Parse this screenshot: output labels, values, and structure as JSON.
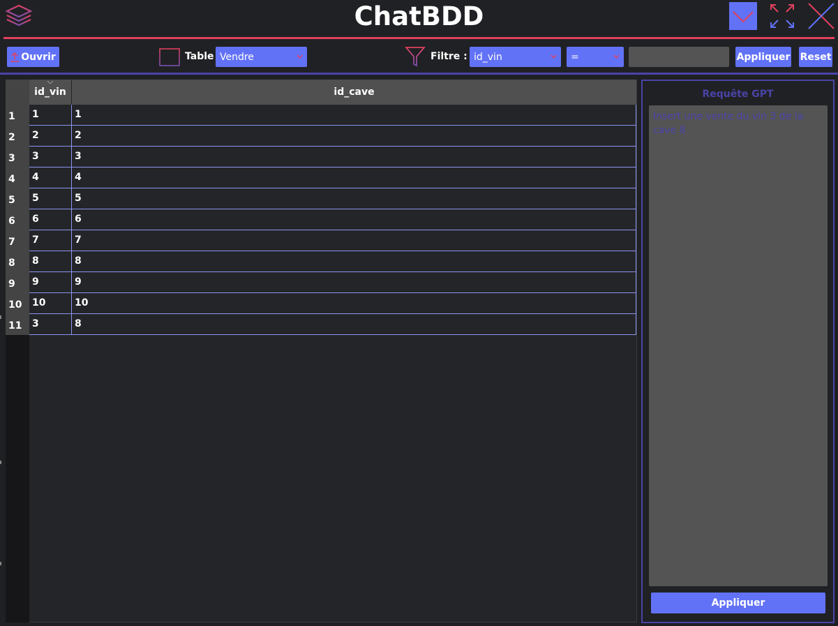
{
  "app": {
    "title": "ChatBDD"
  },
  "toolbar": {
    "open_label": "Ouvrir",
    "table_label": "Table",
    "table_selected": "Vendre",
    "filter_label": "Filtre :",
    "filter_column": "id_vin",
    "filter_operator": "=",
    "filter_value": "",
    "apply_label": "Appliquer",
    "reset_label": "Reset"
  },
  "table": {
    "columns": [
      "id_vin",
      "id_cave"
    ],
    "rows": [
      {
        "num": "1",
        "id_vin": "1",
        "id_cave": "1"
      },
      {
        "num": "2",
        "id_vin": "2",
        "id_cave": "2"
      },
      {
        "num": "3",
        "id_vin": "3",
        "id_cave": "3"
      },
      {
        "num": "4",
        "id_vin": "4",
        "id_cave": "4"
      },
      {
        "num": "5",
        "id_vin": "5",
        "id_cave": "5"
      },
      {
        "num": "6",
        "id_vin": "6",
        "id_cave": "6"
      },
      {
        "num": "7",
        "id_vin": "7",
        "id_cave": "7"
      },
      {
        "num": "8",
        "id_vin": "8",
        "id_cave": "8"
      },
      {
        "num": "9",
        "id_vin": "9",
        "id_cave": "9"
      },
      {
        "num": "10",
        "id_vin": "10",
        "id_cave": "10"
      },
      {
        "num": "11",
        "id_vin": "3",
        "id_cave": "8"
      }
    ]
  },
  "gpt": {
    "title": "Requête GPT",
    "query_text": "Insert une vente du vin 3 de la cave 8",
    "apply_label": "Appliquer"
  },
  "colors": {
    "accent_blue": "#6272f7",
    "accent_red": "#e0405e",
    "accent_purple": "#4a43a8",
    "background": "#1f2023"
  },
  "icons": {
    "app": "layers-icon",
    "minimize": "chevron-down-icon",
    "maximize": "expand-arrows-icon",
    "close": "close-icon",
    "open": "upload-icon",
    "table": "table-grid-icon",
    "filter": "filter-funnel-icon"
  }
}
